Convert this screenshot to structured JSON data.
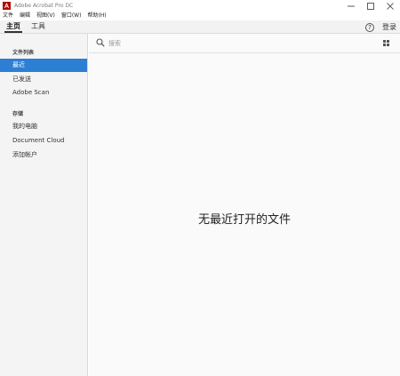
{
  "window": {
    "title": "Adobe Acrobat Pro DC",
    "controls": [
      "minimize-icon",
      "maximize-icon",
      "close-icon"
    ]
  },
  "menubar": {
    "items": [
      {
        "label": "文件"
      },
      {
        "label": "编辑"
      },
      {
        "label": "视图(V)"
      },
      {
        "label": "窗口(W)"
      },
      {
        "label": "帮助(H)"
      }
    ]
  },
  "tabbar": {
    "tabs": [
      {
        "label": "主页",
        "active": true
      },
      {
        "label": "工具",
        "active": false
      }
    ],
    "help_label": "?",
    "signin_label": "登录"
  },
  "sidebar": {
    "section_files": "文件列表",
    "files_items": [
      {
        "label": "最近",
        "active": true
      },
      {
        "label": "已发送",
        "active": false
      },
      {
        "label": "Adobe Scan",
        "active": false
      }
    ],
    "section_storage": "存储",
    "storage_items": [
      {
        "label": "我的电脑"
      },
      {
        "label": "Document Cloud"
      },
      {
        "label": "添加帐户"
      }
    ]
  },
  "search": {
    "placeholder": "搜索",
    "value": ""
  },
  "main": {
    "empty_message": "无最近打开的文件"
  },
  "colors": {
    "accent": "#2d7fd4",
    "brand": "#b30b00"
  },
  "icons": {
    "app": "acrobat-logo-icon",
    "search": "search-icon",
    "view_toggle": "grid-view-icon",
    "help": "help-icon"
  }
}
